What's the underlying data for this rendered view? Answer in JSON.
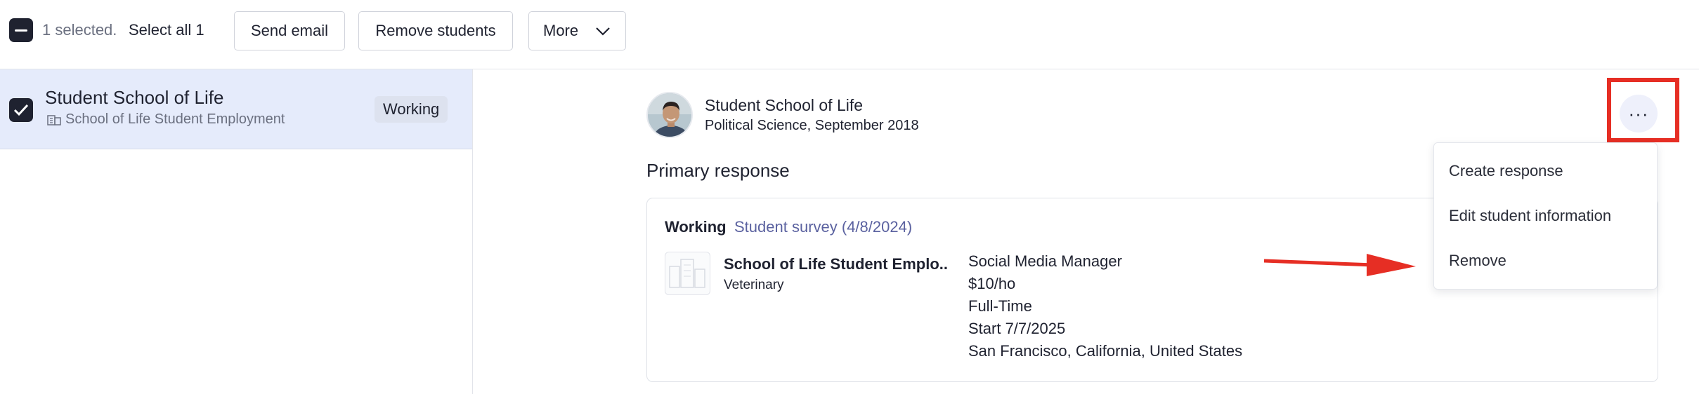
{
  "toolbar": {
    "selected_text": "1 selected.",
    "select_all": "Select all 1",
    "send_email": "Send email",
    "remove_students": "Remove students",
    "more": "More"
  },
  "list": {
    "row_name": "Student School of Life",
    "row_org": "School of Life Student Employment",
    "row_status": "Working"
  },
  "detail": {
    "student_name": "Student School of Life",
    "student_sub": "Political Science, September 2018",
    "primary_title": "Primary response",
    "response": {
      "status": "Working",
      "survey": "Student survey (4/8/2024)",
      "company": "School of Life Student Emplo...",
      "category": "Veterinary",
      "job": [
        "Social Media Manager",
        "$10/ho",
        "Full-Time",
        "Start 7/7/2025",
        "San Francisco, California, United States"
      ]
    }
  },
  "menu": {
    "ellipsis": "···",
    "items": [
      "Create response",
      "Edit student information",
      "Remove"
    ]
  },
  "colors": {
    "accent_red": "#e62e24",
    "row_selected": "#e5ebfb",
    "survey_link": "#5b62a0"
  }
}
